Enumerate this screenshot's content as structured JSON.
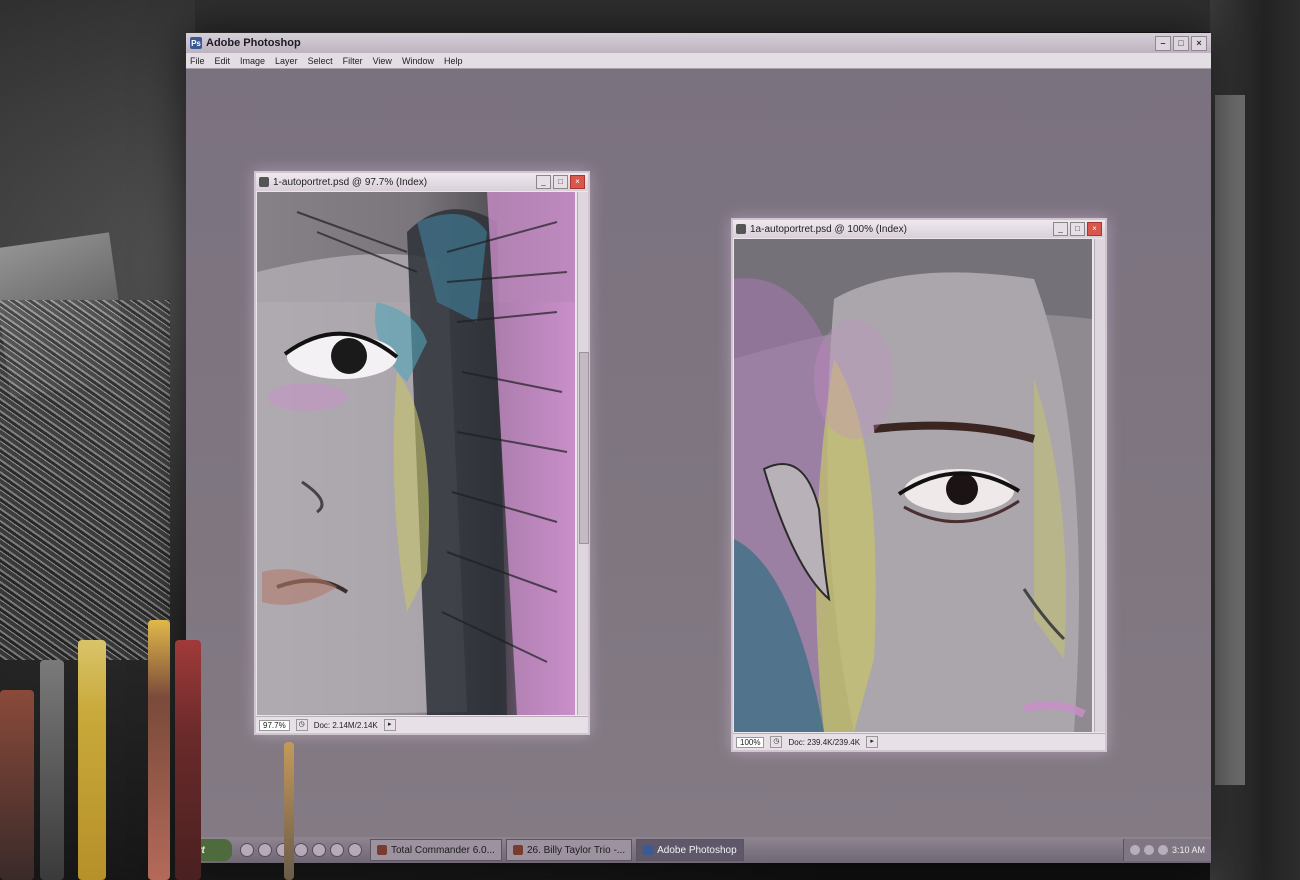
{
  "photoshop": {
    "title": "Adobe Photoshop",
    "menus": [
      "File",
      "Edit",
      "Image",
      "Layer",
      "Select",
      "Filter",
      "View",
      "Window",
      "Help"
    ]
  },
  "documents": [
    {
      "title": "1-autoportret.psd @ 97.7% (Index)",
      "zoom": "97.7%",
      "doc_info": "Doc: 2.14M/2.14K"
    },
    {
      "title": "1a-autoportret.psd @ 100% (Index)",
      "zoom": "100%",
      "doc_info": "Doc: 239.4K/239.4K"
    }
  ],
  "taskbar": {
    "start_label": "art",
    "tasks": [
      {
        "label": "Total Commander 6.0..."
      },
      {
        "label": "26. Billy Taylor Trio -..."
      },
      {
        "label": "Adobe Photoshop"
      }
    ],
    "clock": "3:10 AM"
  },
  "colors": {
    "workspace": "#847b84",
    "titlebar": "#bdb3bf",
    "painting_pink": "#c98fc9",
    "painting_teal": "#3f6f86",
    "painting_yellow": "#c7c46a"
  },
  "icons": {
    "app": "photoshop-icon",
    "minimize": "minimize-icon",
    "maximize": "maximize-icon",
    "close": "close-icon"
  }
}
